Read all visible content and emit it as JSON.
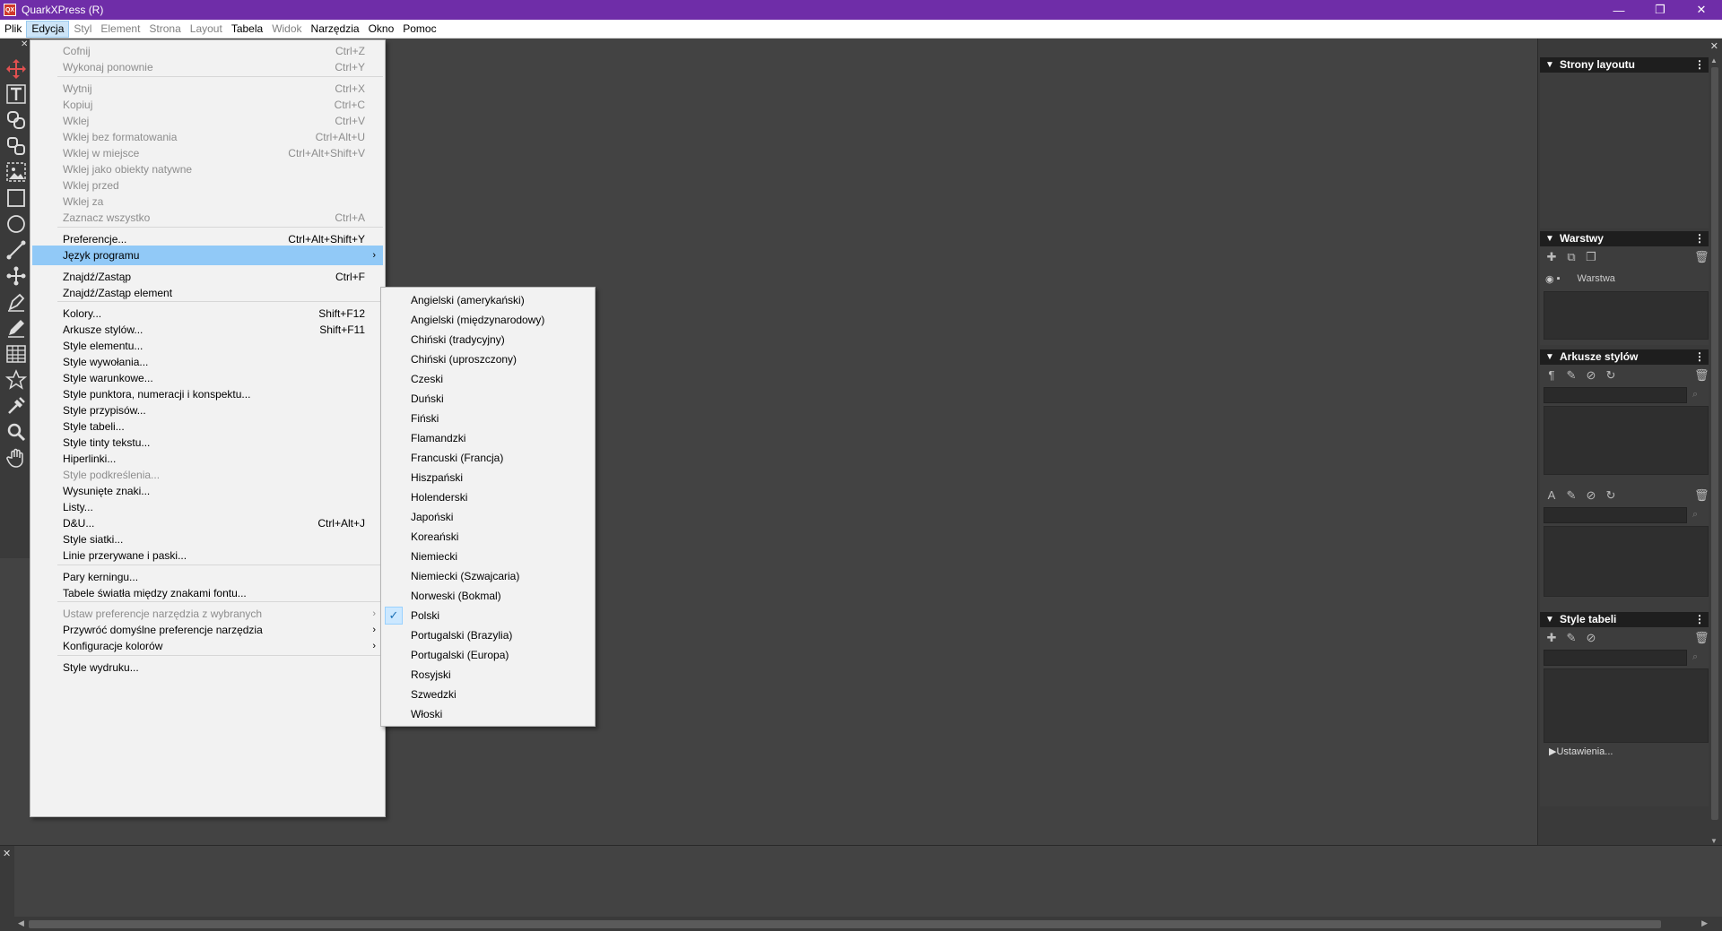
{
  "window": {
    "title": "QuarkXPress (R)",
    "app_icon_text": "QX",
    "controls": {
      "minimize": "—",
      "restore": "❐",
      "close": "✕"
    }
  },
  "menubar": [
    {
      "label": "Plik",
      "state": "normal"
    },
    {
      "label": "Edycja",
      "state": "active"
    },
    {
      "label": "Styl",
      "state": "disabled"
    },
    {
      "label": "Element",
      "state": "disabled"
    },
    {
      "label": "Strona",
      "state": "disabled"
    },
    {
      "label": "Layout",
      "state": "disabled"
    },
    {
      "label": "Tabela",
      "state": "normal"
    },
    {
      "label": "Widok",
      "state": "disabled"
    },
    {
      "label": "Narzędzia",
      "state": "normal"
    },
    {
      "label": "Okno",
      "state": "normal"
    },
    {
      "label": "Pomoc",
      "state": "normal"
    }
  ],
  "tools": [
    "move-tool-icon",
    "text-content-tool-icon",
    "text-linking-tool-icon",
    "text-unlinking-tool-icon",
    "picture-content-tool-icon",
    "rectangle-box-tool-icon",
    "oval-box-tool-icon",
    "line-tool-icon",
    "point-tool-icon",
    "bezier-pen-tool-icon",
    "freehand-tool-icon",
    "table-tool-icon",
    "starburst-tool-icon",
    "eyedropper-tool-icon",
    "zoom-tool-icon",
    "hand-tool-icon"
  ],
  "edit_menu": {
    "items": [
      {
        "label": "Cofnij",
        "shortcut": "Ctrl+Z",
        "disabled": true
      },
      {
        "label": "Wykonaj ponownie",
        "shortcut": "Ctrl+Y",
        "disabled": true
      },
      {
        "label": "Wytnij",
        "shortcut": "Ctrl+X",
        "disabled": true
      },
      {
        "label": "Kopiuj",
        "shortcut": "Ctrl+C",
        "disabled": true
      },
      {
        "label": "Wklej",
        "shortcut": "Ctrl+V",
        "disabled": true
      },
      {
        "label": "Wklej bez formatowania",
        "shortcut": "Ctrl+Alt+U",
        "disabled": true
      },
      {
        "label": "Wklej w miejsce",
        "shortcut": "Ctrl+Alt+Shift+V",
        "disabled": true
      },
      {
        "label": "Wklej jako obiekty natywne",
        "shortcut": "",
        "disabled": true
      },
      {
        "label": "Wklej przed",
        "shortcut": "",
        "disabled": true
      },
      {
        "label": "Wklej za",
        "shortcut": "",
        "disabled": true
      },
      {
        "label": "Zaznacz wszystko",
        "shortcut": "Ctrl+A",
        "disabled": true
      },
      {
        "label": "Preferencje...",
        "shortcut": "Ctrl+Alt+Shift+Y",
        "disabled": false
      },
      {
        "label": "Język programu",
        "shortcut": "",
        "disabled": false,
        "submenu": true,
        "highlighted": true
      },
      {
        "label": "Znajdź/Zastąp",
        "shortcut": "Ctrl+F",
        "disabled": false
      },
      {
        "label": "Znajdź/Zastąp element",
        "shortcut": "",
        "disabled": false
      },
      {
        "label": "Kolory...",
        "shortcut": "Shift+F12",
        "disabled": false
      },
      {
        "label": "Arkusze stylów...",
        "shortcut": "Shift+F11",
        "disabled": false
      },
      {
        "label": "Style elementu...",
        "shortcut": "",
        "disabled": false
      },
      {
        "label": "Style wywołania...",
        "shortcut": "",
        "disabled": false
      },
      {
        "label": "Style warunkowe...",
        "shortcut": "",
        "disabled": false
      },
      {
        "label": "Style punktora, numeracji i konspektu...",
        "shortcut": "",
        "disabled": false
      },
      {
        "label": "Style przypisów...",
        "shortcut": "",
        "disabled": false
      },
      {
        "label": "Style tabeli...",
        "shortcut": "",
        "disabled": false
      },
      {
        "label": "Style tinty tekstu...",
        "shortcut": "",
        "disabled": false
      },
      {
        "label": "Hiperlinki...",
        "shortcut": "",
        "disabled": false
      },
      {
        "label": "Style podkreślenia...",
        "shortcut": "",
        "disabled": true
      },
      {
        "label": "Wysunięte znaki...",
        "shortcut": "",
        "disabled": false
      },
      {
        "label": "Listy...",
        "shortcut": "",
        "disabled": false
      },
      {
        "label": "D&U...",
        "shortcut": "Ctrl+Alt+J",
        "disabled": false
      },
      {
        "label": "Style siatki...",
        "shortcut": "",
        "disabled": false
      },
      {
        "label": "Linie przerywane i paski...",
        "shortcut": "",
        "disabled": false
      },
      {
        "label": "Pary kerningu...",
        "shortcut": "",
        "disabled": false
      },
      {
        "label": "Tabele światła między znakami fontu...",
        "shortcut": "",
        "disabled": false
      },
      {
        "label": "Ustaw preferencje narzędzia z wybranych",
        "shortcut": "",
        "disabled": true,
        "submenu": true
      },
      {
        "label": "Przywróć domyślne preferencje narzędzia",
        "shortcut": "",
        "disabled": false,
        "submenu": true
      },
      {
        "label": "Konfiguracje kolorów",
        "shortcut": "",
        "disabled": false,
        "submenu": true
      },
      {
        "label": "Style wydruku...",
        "shortcut": "",
        "disabled": false
      }
    ],
    "submenu_arrow": "›"
  },
  "language_submenu": {
    "items": [
      {
        "label": "Angielski (amerykański)",
        "checked": false
      },
      {
        "label": "Angielski (międzynarodowy)",
        "checked": false
      },
      {
        "label": "Chiński (tradycyjny)",
        "checked": false
      },
      {
        "label": "Chiński (uproszczony)",
        "checked": false
      },
      {
        "label": "Czeski",
        "checked": false
      },
      {
        "label": "Duński",
        "checked": false
      },
      {
        "label": "Fiński",
        "checked": false
      },
      {
        "label": "Flamandzki",
        "checked": false
      },
      {
        "label": "Francuski (Francja)",
        "checked": false
      },
      {
        "label": "Hiszpański",
        "checked": false
      },
      {
        "label": "Holenderski",
        "checked": false
      },
      {
        "label": "Japoński",
        "checked": false
      },
      {
        "label": "Koreański",
        "checked": false
      },
      {
        "label": "Niemiecki",
        "checked": false
      },
      {
        "label": "Niemiecki (Szwajcaria)",
        "checked": false
      },
      {
        "label": "Norweski (Bokmal)",
        "checked": false
      },
      {
        "label": "Polski",
        "checked": true
      },
      {
        "label": "Portugalski (Brazylia)",
        "checked": false
      },
      {
        "label": "Portugalski (Europa)",
        "checked": false
      },
      {
        "label": "Rosyjski",
        "checked": false
      },
      {
        "label": "Szwedzki",
        "checked": false
      },
      {
        "label": "Włoski",
        "checked": false
      }
    ],
    "check_glyph": "✓"
  },
  "panels": {
    "layout_pages": {
      "title": "Strony layoutu"
    },
    "layers": {
      "title": "Warstwy",
      "layer_name": "Warstwa"
    },
    "stylesheets": {
      "title": "Arkusze stylów"
    },
    "table_styles": {
      "title": "Style tabeli",
      "settings_label": "Ustawienia..."
    }
  },
  "colors": {
    "titlebar": "#6f2da8",
    "menu_highlight": "#91c9f7",
    "canvas": "#434343"
  }
}
